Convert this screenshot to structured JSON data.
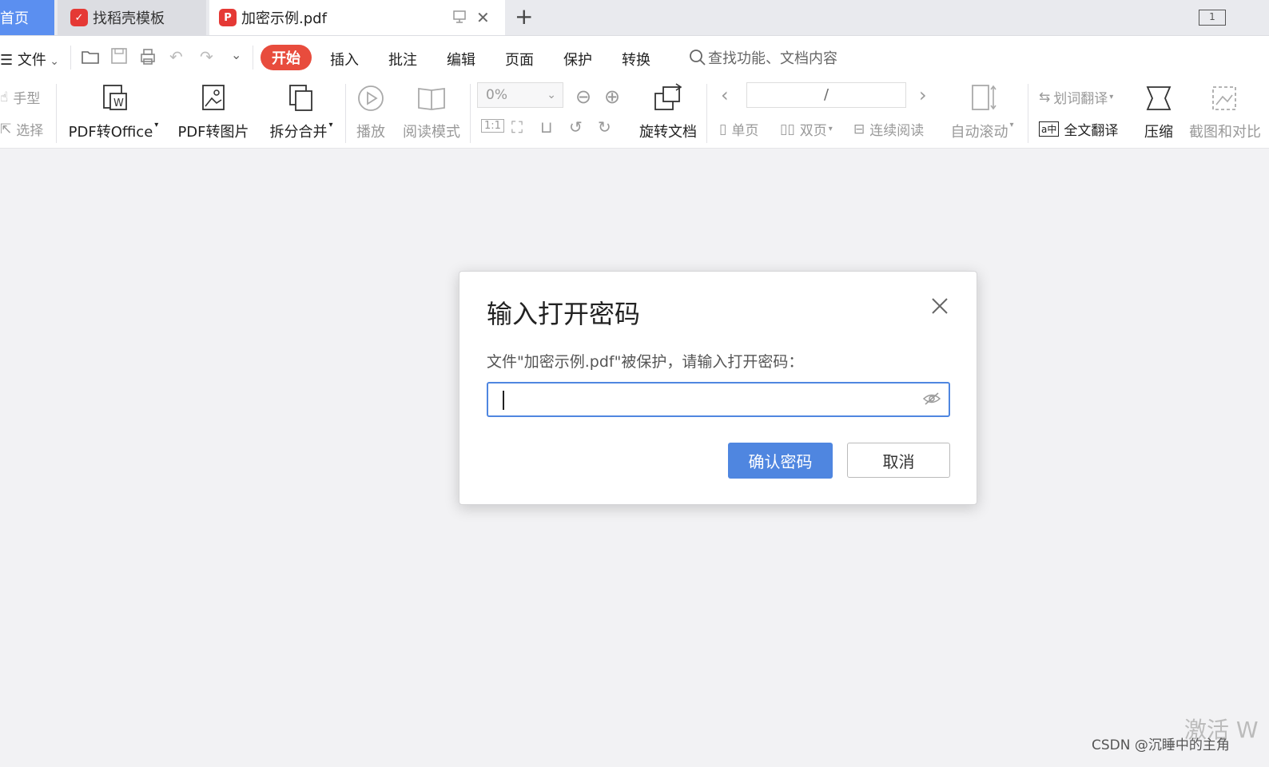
{
  "tabs": {
    "home": "首页",
    "templates": "找稻壳模板",
    "document": "加密示例.pdf",
    "new_tab": "+"
  },
  "tabbar_right": {
    "layout_box": "1"
  },
  "menu": {
    "file": "文件",
    "items": [
      "开始",
      "插入",
      "批注",
      "编辑",
      "页面",
      "保护",
      "转换"
    ],
    "search_placeholder": "查找功能、文档内容"
  },
  "toolbar": {
    "hand": "手型",
    "select": "选择",
    "pdf_to_office": "PDF转Office",
    "pdf_to_image": "PDF转图片",
    "split_merge": "拆分合并",
    "play": "播放",
    "read_mode": "阅读模式",
    "zoom_value": "0%",
    "rotate_doc": "旋转文档",
    "page_separator": "/",
    "single_page": "单页",
    "double_page": "双页",
    "continuous_read": "连续阅读",
    "auto_scroll": "自动滚动",
    "word_translate": "划词翻译",
    "full_translate": "全文翻译",
    "compress": "压缩",
    "screenshot_compare": "截图和对比"
  },
  "dialog": {
    "title": "输入打开密码",
    "message": "文件\"加密示例.pdf\"被保护，请输入打开密码：",
    "password_value": "",
    "confirm": "确认密码",
    "cancel": "取消"
  },
  "footer": {
    "watermark": "CSDN @沉睡中的主角",
    "activate": "激活 W"
  },
  "colors": {
    "accent": "#4f86e0",
    "active_menu": "#e84c3d",
    "home_tab": "#5b8ff0"
  }
}
